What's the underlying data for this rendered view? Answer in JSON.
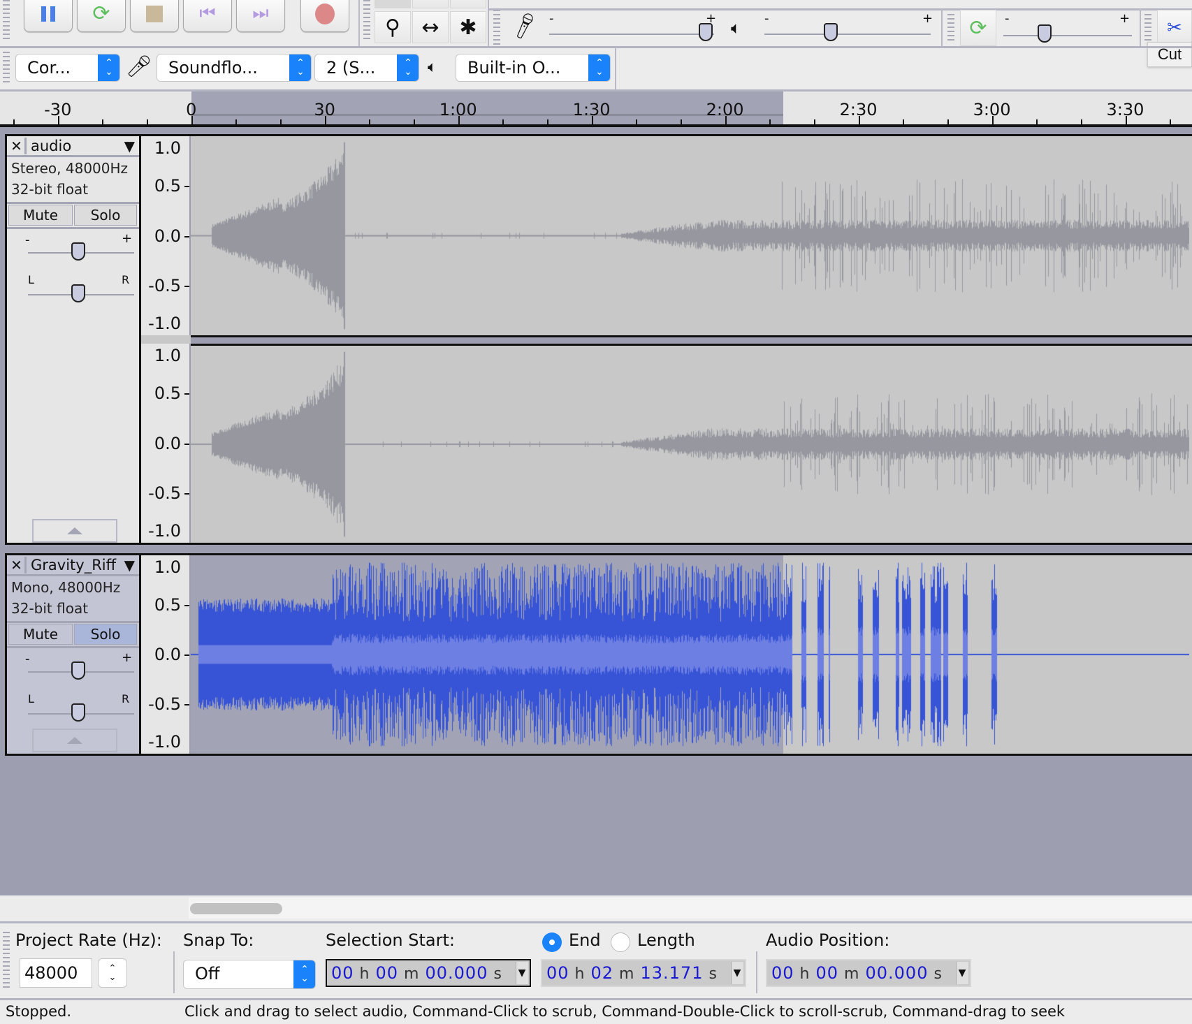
{
  "app": "Audacity",
  "transport": {
    "buttons": [
      {
        "name": "pause-button",
        "icon": "pause-icon",
        "label": "Pause"
      },
      {
        "name": "loop-play-button",
        "icon": "loop-icon",
        "label": "Play"
      },
      {
        "name": "stop-button",
        "icon": "stop-icon",
        "label": "Stop"
      },
      {
        "name": "skip-start-button",
        "icon": "skip-start-icon",
        "label": "Skip to Start"
      },
      {
        "name": "skip-end-button",
        "icon": "skip-end-icon",
        "label": "Skip to End"
      },
      {
        "name": "record-button",
        "icon": "record-icon",
        "label": "Record"
      }
    ]
  },
  "tools": {
    "items": [
      {
        "name": "zoom-tool",
        "glyph": "⚲"
      },
      {
        "name": "timeshift-tool",
        "glyph": "↔"
      },
      {
        "name": "multi-tool",
        "glyph": "✱"
      }
    ]
  },
  "meters": {
    "record_volume": 0.95,
    "playback_volume": 0.4,
    "minus": "-",
    "plus": "+"
  },
  "playat_speed": {
    "value": 0.32,
    "minus": "-",
    "plus": "+"
  },
  "edit": {
    "cut_tooltip": "Cut"
  },
  "device": {
    "host": "Cor...",
    "recording_device": "Soundflo...",
    "channels": "2 (S...",
    "playback_device": "Built-in O..."
  },
  "ruler": {
    "labels": [
      {
        "text": "-30",
        "t": -30
      },
      {
        "text": "0",
        "t": 0
      },
      {
        "text": "30",
        "t": 30
      },
      {
        "text": "1:00",
        "t": 60
      },
      {
        "text": "1:30",
        "t": 90
      },
      {
        "text": "2:00",
        "t": 120
      },
      {
        "text": "2:30",
        "t": 150
      },
      {
        "text": "3:00",
        "t": 180
      },
      {
        "text": "3:30",
        "t": 210
      }
    ],
    "view_start_seconds": -43,
    "view_end_seconds": 225,
    "selection_start_seconds": 0,
    "selection_end_seconds": 133.171
  },
  "tracks": [
    {
      "name": "audio",
      "format": "Stereo, 48000Hz",
      "bit_depth": "32-bit float",
      "mute_label": "Mute",
      "solo_label": "Solo",
      "solo_active": false,
      "selected": false,
      "gain": 0.5,
      "pan": 0.5,
      "gain_minus": "-",
      "gain_plus": "+",
      "pan_left": "L",
      "pan_right": "R",
      "channels": 2,
      "wave_color": "#9797a0",
      "vruler": [
        "1.0",
        "0.5",
        "0.0",
        "-0.5",
        "-1.0"
      ]
    },
    {
      "name": "Gravity_Riff",
      "format": "Mono, 48000Hz",
      "bit_depth": "32-bit float",
      "mute_label": "Mute",
      "solo_label": "Solo",
      "solo_active": true,
      "selected": true,
      "gain": 0.5,
      "pan": 0.5,
      "gain_minus": "-",
      "gain_plus": "+",
      "pan_left": "L",
      "pan_right": "R",
      "channels": 1,
      "wave_color": "#3754d6",
      "rms_color": "#6d7fe3",
      "vruler": [
        "1.0",
        "0.5",
        "0.0",
        "-0.5",
        "-1.0"
      ]
    }
  ],
  "selection_toolbar": {
    "project_rate_label": "Project Rate (Hz):",
    "project_rate": "48000",
    "snap_label": "Snap To:",
    "snap_value": "Off",
    "selection_start_label": "Selection Start:",
    "end_label": "End",
    "length_label": "Length",
    "end_selected": true,
    "audio_position_label": "Audio Position:",
    "selection_start": {
      "h": "00",
      "m": "00",
      "s": "00.000"
    },
    "selection_end": {
      "h": "00",
      "m": "02",
      "s": "13.171"
    },
    "audio_position": {
      "h": "00",
      "m": "00",
      "s": "00.000"
    },
    "unit_h": "h",
    "unit_m": "m",
    "unit_s": "s"
  },
  "status": {
    "state": "Stopped.",
    "hint": "Click and drag to select audio, Command-Click to scrub, Command-Double-Click to scroll-scrub, Command-drag to seek"
  },
  "colors": {
    "selection": "#a2a4b6",
    "accent": "#1a82fb",
    "track_bg": "#c8c8c8"
  }
}
